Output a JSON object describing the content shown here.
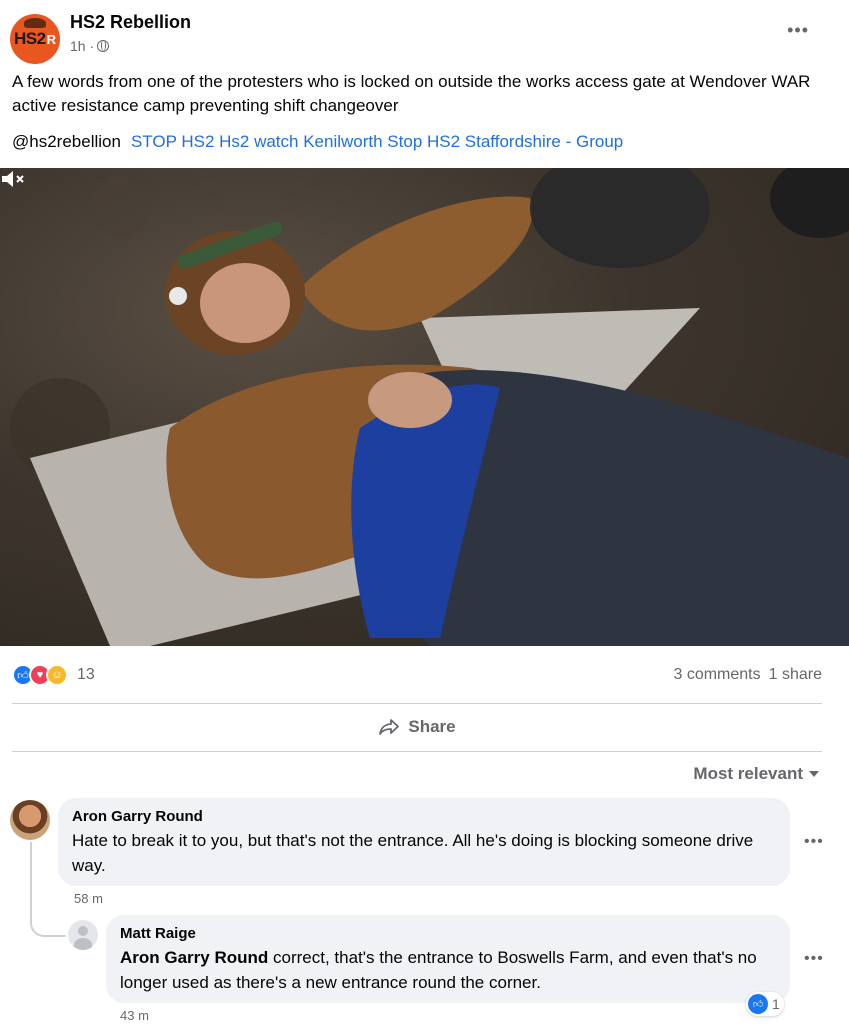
{
  "page": {
    "name": "HS2 Rebellion",
    "time": "1h ·",
    "logo_text": "HS2",
    "logo_r": "R",
    "more": "•••"
  },
  "post": {
    "text": "A few words from one of the protesters who is locked on outside the works access gate at Wendover WAR active resistance camp preventing shift changeover",
    "tags": [
      "@hs2rebellion",
      "STOP HS2 Hs2 watch Kenilworth Stop HS2 Staffordshire - Group"
    ]
  },
  "video": {
    "muted": true
  },
  "stats": {
    "reaction_count": "13",
    "comments": "3 comments",
    "shares": "1 share"
  },
  "actions": {
    "share": "Share"
  },
  "comments_sort": "Most relevant",
  "comments": [
    {
      "author": "Aron Garry Round",
      "text": "Hate to break it to you, but that's not the entrance. All he's doing is blocking someone drive way.",
      "time": "58 m",
      "more": "•••"
    },
    {
      "author": "Matt Raige",
      "mention": "Aron Garry Round",
      "text": " correct, that's the entrance to Boswells Farm, and even that's no longer used as there's a new entrance round the corner.",
      "time": "43 m",
      "reaction_count": "1",
      "more": "•••"
    }
  ],
  "colors": {
    "link": "#216fdb",
    "accent": "#1877f2",
    "logo_bg": "#e8571f"
  }
}
